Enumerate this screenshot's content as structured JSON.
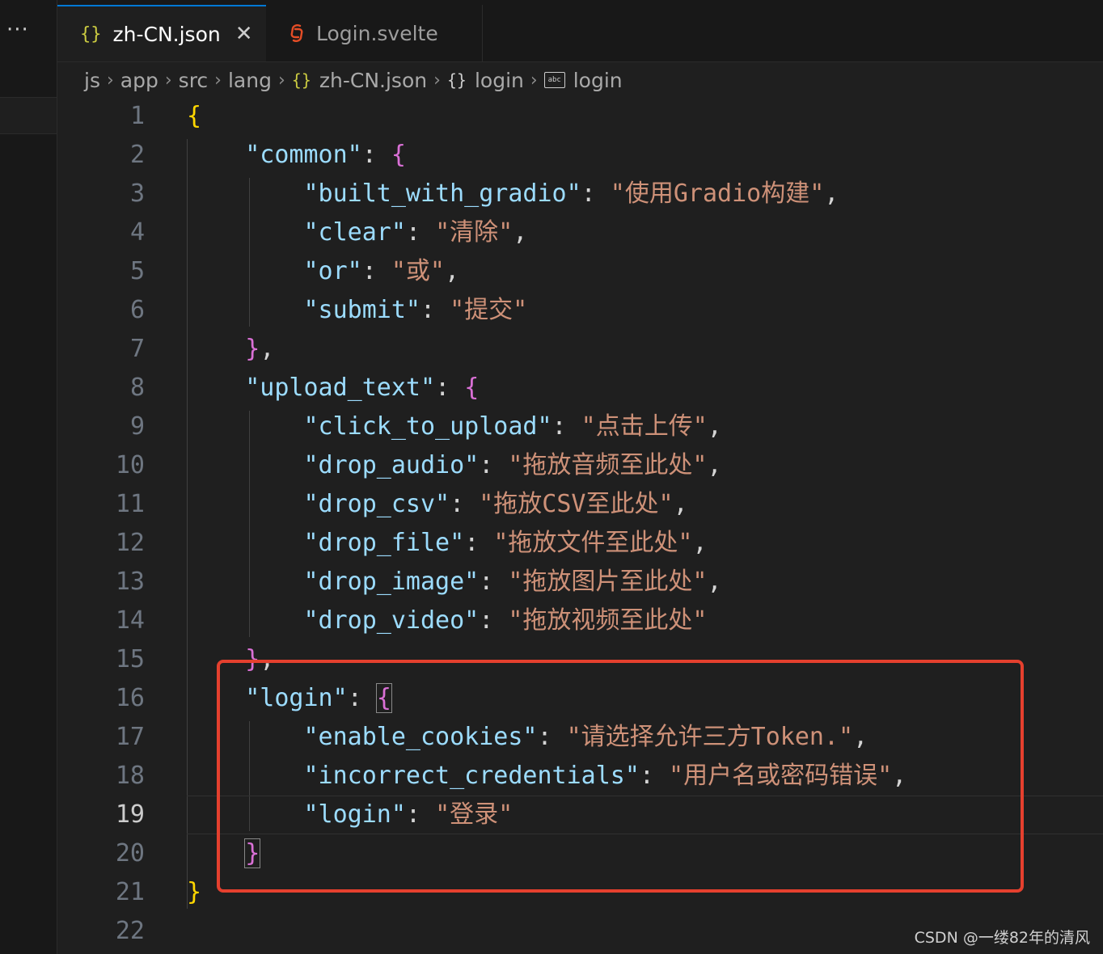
{
  "toolbar": {
    "more_label": "···"
  },
  "tabs": [
    {
      "icon": "json-icon",
      "icon_glyph": "{}",
      "label": "zh-CN.json",
      "active": true,
      "close_glyph": "✕"
    },
    {
      "icon": "svelte-icon",
      "label": "Login.svelte",
      "active": false
    }
  ],
  "breadcrumb": {
    "segments": [
      "js",
      "app",
      "src",
      "lang"
    ],
    "file_glyph": "{}",
    "file": "zh-CN.json",
    "object_glyph": "{}",
    "object": "login",
    "string_glyph": "abc",
    "string": "login",
    "separator": "›"
  },
  "editor": {
    "current_line": 19,
    "lines": [
      {
        "n": "1",
        "tokens": [
          [
            "b1",
            "{"
          ]
        ]
      },
      {
        "n": "2",
        "tokens": [
          [
            "ind",
            "    "
          ],
          [
            "key",
            "\"common\""
          ],
          [
            "punc",
            ": "
          ],
          [
            "b2",
            "{"
          ]
        ]
      },
      {
        "n": "3",
        "tokens": [
          [
            "ind",
            "        "
          ],
          [
            "key",
            "\"built_with_gradio\""
          ],
          [
            "punc",
            ": "
          ],
          [
            "str",
            "\"使用Gradio构建\""
          ],
          [
            "punc",
            ","
          ]
        ]
      },
      {
        "n": "4",
        "tokens": [
          [
            "ind",
            "        "
          ],
          [
            "key",
            "\"clear\""
          ],
          [
            "punc",
            ": "
          ],
          [
            "str",
            "\"清除\""
          ],
          [
            "punc",
            ","
          ]
        ]
      },
      {
        "n": "5",
        "tokens": [
          [
            "ind",
            "        "
          ],
          [
            "key",
            "\"or\""
          ],
          [
            "punc",
            ": "
          ],
          [
            "str",
            "\"或\""
          ],
          [
            "punc",
            ","
          ]
        ]
      },
      {
        "n": "6",
        "tokens": [
          [
            "ind",
            "        "
          ],
          [
            "key",
            "\"submit\""
          ],
          [
            "punc",
            ": "
          ],
          [
            "str",
            "\"提交\""
          ]
        ]
      },
      {
        "n": "7",
        "tokens": [
          [
            "ind",
            "    "
          ],
          [
            "b2",
            "}"
          ],
          [
            "punc",
            ","
          ]
        ]
      },
      {
        "n": "8",
        "tokens": [
          [
            "ind",
            "    "
          ],
          [
            "key",
            "\"upload_text\""
          ],
          [
            "punc",
            ": "
          ],
          [
            "b2",
            "{"
          ]
        ]
      },
      {
        "n": "9",
        "tokens": [
          [
            "ind",
            "        "
          ],
          [
            "key",
            "\"click_to_upload\""
          ],
          [
            "punc",
            ": "
          ],
          [
            "str",
            "\"点击上传\""
          ],
          [
            "punc",
            ","
          ]
        ]
      },
      {
        "n": "10",
        "tokens": [
          [
            "ind",
            "        "
          ],
          [
            "key",
            "\"drop_audio\""
          ],
          [
            "punc",
            ": "
          ],
          [
            "str",
            "\"拖放音频至此处\""
          ],
          [
            "punc",
            ","
          ]
        ]
      },
      {
        "n": "11",
        "tokens": [
          [
            "ind",
            "        "
          ],
          [
            "key",
            "\"drop_csv\""
          ],
          [
            "punc",
            ": "
          ],
          [
            "str",
            "\"拖放CSV至此处\""
          ],
          [
            "punc",
            ","
          ]
        ]
      },
      {
        "n": "12",
        "tokens": [
          [
            "ind",
            "        "
          ],
          [
            "key",
            "\"drop_file\""
          ],
          [
            "punc",
            ": "
          ],
          [
            "str",
            "\"拖放文件至此处\""
          ],
          [
            "punc",
            ","
          ]
        ]
      },
      {
        "n": "13",
        "tokens": [
          [
            "ind",
            "        "
          ],
          [
            "key",
            "\"drop_image\""
          ],
          [
            "punc",
            ": "
          ],
          [
            "str",
            "\"拖放图片至此处\""
          ],
          [
            "punc",
            ","
          ]
        ]
      },
      {
        "n": "14",
        "tokens": [
          [
            "ind",
            "        "
          ],
          [
            "key",
            "\"drop_video\""
          ],
          [
            "punc",
            ": "
          ],
          [
            "str",
            "\"拖放视频至此处\""
          ]
        ]
      },
      {
        "n": "15",
        "tokens": [
          [
            "ind",
            "    "
          ],
          [
            "b2",
            "}"
          ],
          [
            "punc",
            ","
          ]
        ]
      },
      {
        "n": "16",
        "tokens": [
          [
            "ind",
            "    "
          ],
          [
            "key",
            "\"login\""
          ],
          [
            "punc",
            ": "
          ],
          [
            "b2m",
            "{"
          ]
        ]
      },
      {
        "n": "17",
        "tokens": [
          [
            "ind",
            "        "
          ],
          [
            "key",
            "\"enable_cookies\""
          ],
          [
            "punc",
            ": "
          ],
          [
            "str",
            "\"请选择允许三方Token.\""
          ],
          [
            "punc",
            ","
          ]
        ]
      },
      {
        "n": "18",
        "tokens": [
          [
            "ind",
            "        "
          ],
          [
            "key",
            "\"incorrect_credentials\""
          ],
          [
            "punc",
            ": "
          ],
          [
            "str",
            "\"用户名或密码错误\""
          ],
          [
            "punc",
            ","
          ]
        ]
      },
      {
        "n": "19",
        "tokens": [
          [
            "ind",
            "        "
          ],
          [
            "key",
            "\"login\""
          ],
          [
            "punc",
            ": "
          ],
          [
            "str",
            "\"登录\""
          ]
        ]
      },
      {
        "n": "20",
        "tokens": [
          [
            "ind",
            "    "
          ],
          [
            "b2m",
            "}"
          ]
        ]
      },
      {
        "n": "21",
        "tokens": [
          [
            "b1",
            "}"
          ]
        ]
      },
      {
        "n": "22",
        "tokens": []
      }
    ]
  },
  "colors": {
    "highlight_box": "#e5402e",
    "json_key": "#9cdcfe",
    "json_string": "#ce9178",
    "bracket_level1": "#ffd700",
    "bracket_level2": "#da70d6",
    "active_tab_border": "#0078d4"
  },
  "watermark": "CSDN @一缕82年的清风"
}
